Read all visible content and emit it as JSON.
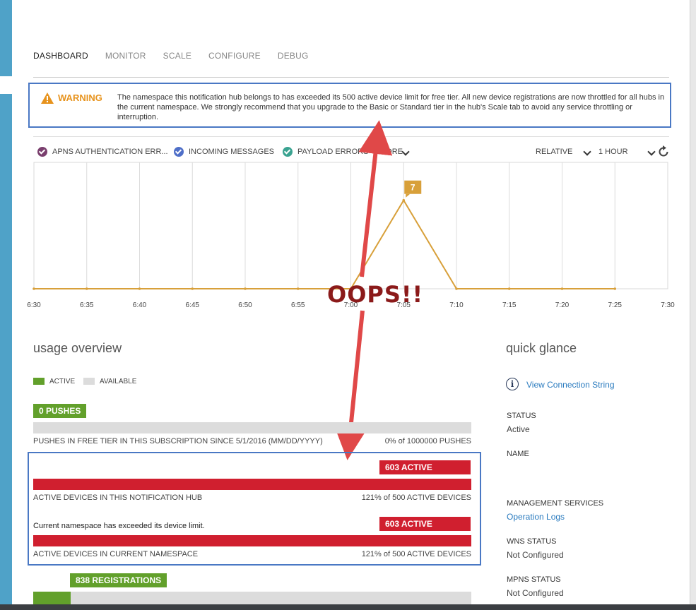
{
  "tabs": [
    "DASHBOARD",
    "MONITOR",
    "SCALE",
    "CONFIGURE",
    "DEBUG"
  ],
  "warning": {
    "title": "WARNING",
    "text": "The namespace this notification hub belongs to has exceeded its 500 active device limit for free tier. All new device registrations are now throttled for all hubs in the current namespace. We strongly recommend that you upgrade to the Basic or Standard tier in the hub's Scale tab to avoid any service throttling or interruption."
  },
  "chart_controls": {
    "metrics": [
      {
        "label": "APNS AUTHENTICATION ERR...",
        "color": "#7a3f6e"
      },
      {
        "label": "INCOMING MESSAGES",
        "color": "#4f6fc8"
      },
      {
        "label": "PAYLOAD ERRORS",
        "color": "#3aa391"
      }
    ],
    "more_label": "MORE",
    "relative_label": "RELATIVE",
    "range_label": "1 HOUR"
  },
  "chart_data": {
    "type": "line",
    "x": [
      "6:30",
      "6:35",
      "6:40",
      "6:45",
      "6:50",
      "6:55",
      "7:00",
      "7:05",
      "7:10",
      "7:15",
      "7:20",
      "7:25",
      "7:30"
    ],
    "series": [
      {
        "values": [
          0,
          0,
          0,
          0,
          0,
          0,
          0,
          7,
          0,
          0,
          0,
          0,
          null
        ],
        "color": "#d8a03a"
      }
    ],
    "data_labels": [
      {
        "x": "7:05",
        "value": "7"
      }
    ],
    "grid": true
  },
  "annotation": "OOPS!!",
  "usage": {
    "title": "usage overview",
    "legend_active": "ACTIVE",
    "legend_available": "AVAILABLE",
    "pushes": {
      "badge": "0 PUSHES",
      "caption_left": "PUSHES IN FREE TIER IN THIS SUBSCRIPTION SINCE 5/1/2016 (MM/DD/YYYY)",
      "caption_right": "0% of 1000000 PUSHES",
      "fill_fraction": 0
    },
    "hub_devices": {
      "badge": "603 ACTIVE DEVICES",
      "caption_left": "ACTIVE DEVICES IN THIS NOTIFICATION HUB",
      "caption_right": "121% of 500 ACTIVE DEVICES",
      "fill_fraction": 1
    },
    "namespace_devices": {
      "note": "Current namespace has exceeded its device limit.",
      "badge": "603 ACTIVE DEVICES",
      "caption_left": "ACTIVE DEVICES IN CURRENT NAMESPACE",
      "caption_right": "121% of 500 ACTIVE DEVICES",
      "fill_fraction": 1
    },
    "registrations": {
      "badge": "838 REGISTRATIONS",
      "fill_fraction": 0.085
    }
  },
  "quick_glance": {
    "title": "quick glance",
    "connection_link": "View Connection String",
    "status_label": "STATUS",
    "status_value": "Active",
    "name_label": "NAME",
    "mgmt_label": "MANAGEMENT SERVICES",
    "mgmt_link": "Operation Logs",
    "wns_label": "WNS STATUS",
    "wns_value": "Not Configured",
    "mpns_label": "MPNS STATUS",
    "mpns_value": "Not Configured"
  },
  "colors": {
    "accent_blue": "#4a78c4",
    "warning_orange": "#e7931d",
    "active_green": "#62a02b",
    "over_red": "#d01f2f",
    "oops_red": "#8b1a1a",
    "arrow_red": "#e04848"
  }
}
